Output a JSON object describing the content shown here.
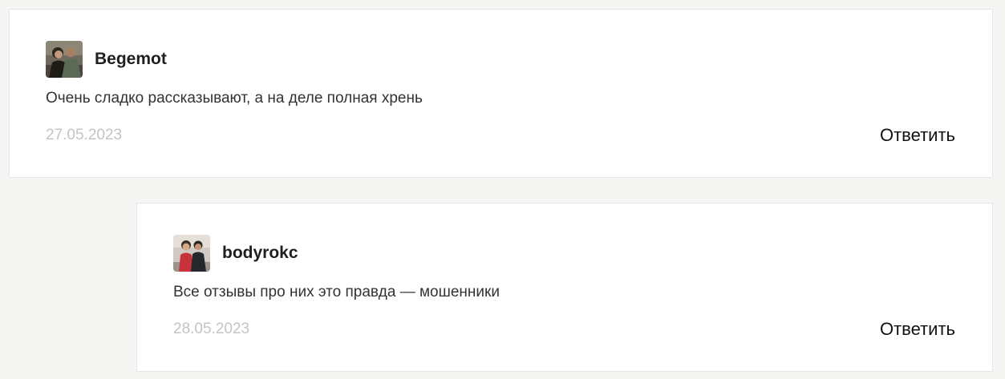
{
  "comments": [
    {
      "author": "Begemot",
      "text": "Очень сладко рассказывают, а на деле полная хрень",
      "date": "27.05.2023",
      "reply_label": "Ответить",
      "avatar_icon": "user-photo-avatar"
    },
    {
      "author": "bodyrokc",
      "text": "Все отзывы про них это правда — мошенники",
      "date": "28.05.2023",
      "reply_label": "Ответить",
      "avatar_icon": "user-photo-avatar"
    }
  ],
  "colors": {
    "page_background": "#f5f5f3",
    "card_background": "#ffffff",
    "card_border": "#e6e6e3",
    "date_text": "#c4c4c4"
  }
}
